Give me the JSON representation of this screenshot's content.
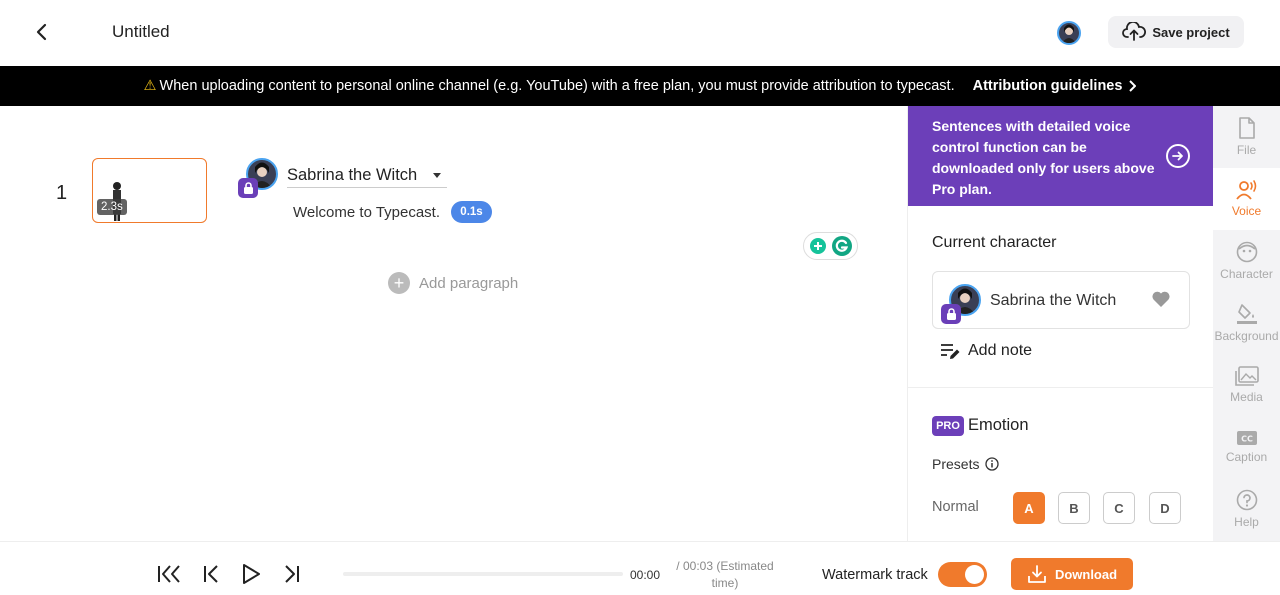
{
  "header": {
    "title": "Untitled",
    "save_label": "Save project"
  },
  "banner": {
    "message": "When uploading content to personal online channel (e.g. YouTube) with a free plan, you must provide attribution to typecast.",
    "link_label": "Attribution guidelines"
  },
  "editor": {
    "paragraphs": [
      {
        "number": "1",
        "thumbnail_duration": "2.3s",
        "character": "Sabrina the Witch",
        "sentence": "Welcome to Typecast.",
        "pause": "0.1s"
      }
    ],
    "add_paragraph_label": "Add paragraph"
  },
  "panel": {
    "promo": "Sentences with detailed voice control function can be downloaded only for users above Pro plan.",
    "current_character_title": "Current character",
    "character_name": "Sabrina the Witch",
    "add_note_label": "Add note",
    "pro_badge": "PRO",
    "emotion_title": "Emotion",
    "presets_label": "Presets",
    "normal_label": "Normal",
    "presets": [
      "A",
      "B",
      "C",
      "D"
    ],
    "active_preset": "A"
  },
  "sidenav": {
    "items": [
      {
        "label": "File",
        "icon": "file-icon"
      },
      {
        "label": "Voice",
        "icon": "voice-icon"
      },
      {
        "label": "Character",
        "icon": "character-icon"
      },
      {
        "label": "Background",
        "icon": "background-icon"
      },
      {
        "label": "Media",
        "icon": "media-icon"
      },
      {
        "label": "Caption",
        "icon": "caption-icon"
      },
      {
        "label": "Help",
        "icon": "help-icon"
      }
    ],
    "active": "Voice"
  },
  "player": {
    "current_time": "00:00",
    "total_time": "/ 00:03 (Estimated time)",
    "progress": 0,
    "watermark_label": "Watermark track",
    "watermark_on": true,
    "download_label": "Download"
  },
  "colors": {
    "accent": "#f07a2c",
    "purple": "#6c3fb9",
    "chip_blue": "#4c87e8"
  }
}
